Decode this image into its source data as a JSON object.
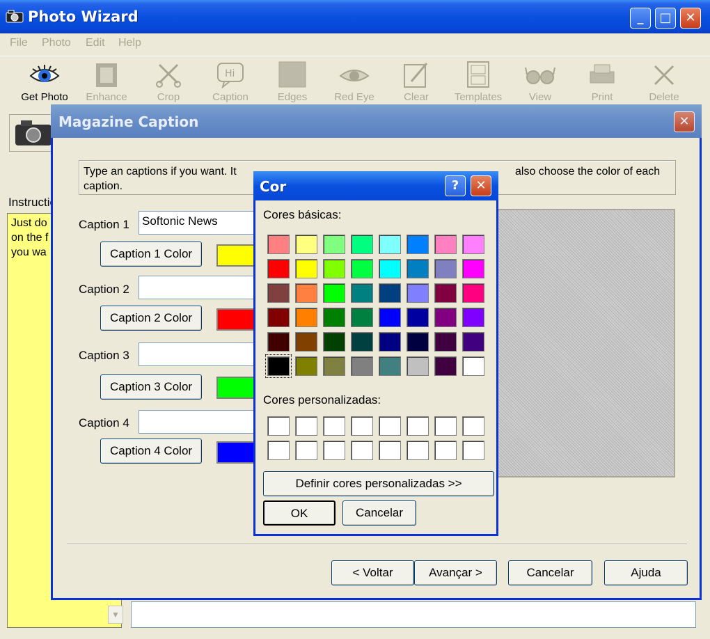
{
  "main_window": {
    "title": "Photo Wizard",
    "menu": [
      "File",
      "Photo",
      "Edit",
      "Help"
    ],
    "toolbar": [
      "Get Photo",
      "Enhance",
      "Crop",
      "Caption",
      "Edges",
      "Red Eye",
      "Clear",
      "Templates",
      "View",
      "Print",
      "Delete"
    ],
    "left_label": "Instructio",
    "instructions_text": "Just do\non the f\nyou wa"
  },
  "magazine_caption": {
    "title": "Magazine Caption",
    "instructions": "Type an captions if you want.  It will ... also choose the color of each caption.",
    "instructions_left": "Type an captions if you want.  It",
    "instructions_right": "also choose the color of each",
    "instructions_line2": "caption.",
    "captions": [
      {
        "label": "Caption 1",
        "value": "Softonic News",
        "button": "Caption 1 Color",
        "color": "#ffff00"
      },
      {
        "label": "Caption 2",
        "value": "",
        "button": "Caption 2 Color",
        "color": "#ff0000"
      },
      {
        "label": "Caption 3",
        "value": "",
        "button": "Caption 3 Color",
        "color": "#00ff00"
      },
      {
        "label": "Caption 4",
        "value": "",
        "button": "Caption 4 Color",
        "color": "#0000ff"
      }
    ],
    "nav_buttons": {
      "back": "< Voltar",
      "next": "Avançar >",
      "cancel": "Cancelar",
      "help": "Ajuda"
    }
  },
  "color_dialog": {
    "title": "Cor",
    "help_glyph": "?",
    "basic_label": "Cores básicas:",
    "custom_label": "Cores personalizadas:",
    "define_button": "Definir cores personalizadas >>",
    "ok_button": "OK",
    "cancel_button": "Cancelar",
    "selected_index": 40,
    "basic_colors": [
      "#ff8080",
      "#ffff80",
      "#80ff80",
      "#00ff80",
      "#80ffff",
      "#0080ff",
      "#ff80c0",
      "#ff80ff",
      "#ff0000",
      "#ffff00",
      "#80ff00",
      "#00ff40",
      "#00ffff",
      "#0080c0",
      "#8080c0",
      "#ff00ff",
      "#804040",
      "#ff8040",
      "#00ff00",
      "#008080",
      "#004080",
      "#8080ff",
      "#800040",
      "#ff0080",
      "#800000",
      "#ff8000",
      "#008000",
      "#008040",
      "#0000ff",
      "#0000a0",
      "#800080",
      "#8000ff",
      "#400000",
      "#804000",
      "#004000",
      "#004040",
      "#000080",
      "#000040",
      "#400040",
      "#400080",
      "#000000",
      "#808000",
      "#808040",
      "#808080",
      "#408080",
      "#c0c0c0",
      "#400040",
      "#ffffff"
    ],
    "custom_colors": [
      "#ffffff",
      "#ffffff",
      "#ffffff",
      "#ffffff",
      "#ffffff",
      "#ffffff",
      "#ffffff",
      "#ffffff",
      "#ffffff",
      "#ffffff",
      "#ffffff",
      "#ffffff",
      "#ffffff",
      "#ffffff",
      "#ffffff",
      "#ffffff"
    ]
  }
}
